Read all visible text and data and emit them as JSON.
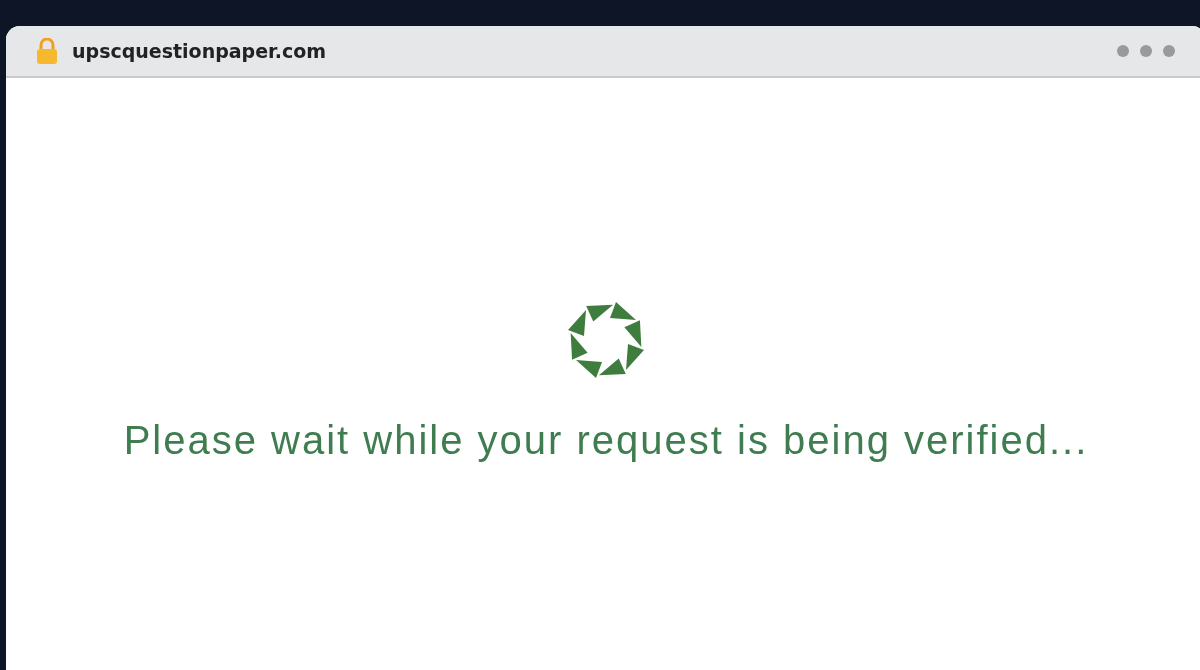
{
  "browser": {
    "url": "upscquestionpaper.com"
  },
  "page": {
    "message": "Please wait while your request is being verified..."
  }
}
